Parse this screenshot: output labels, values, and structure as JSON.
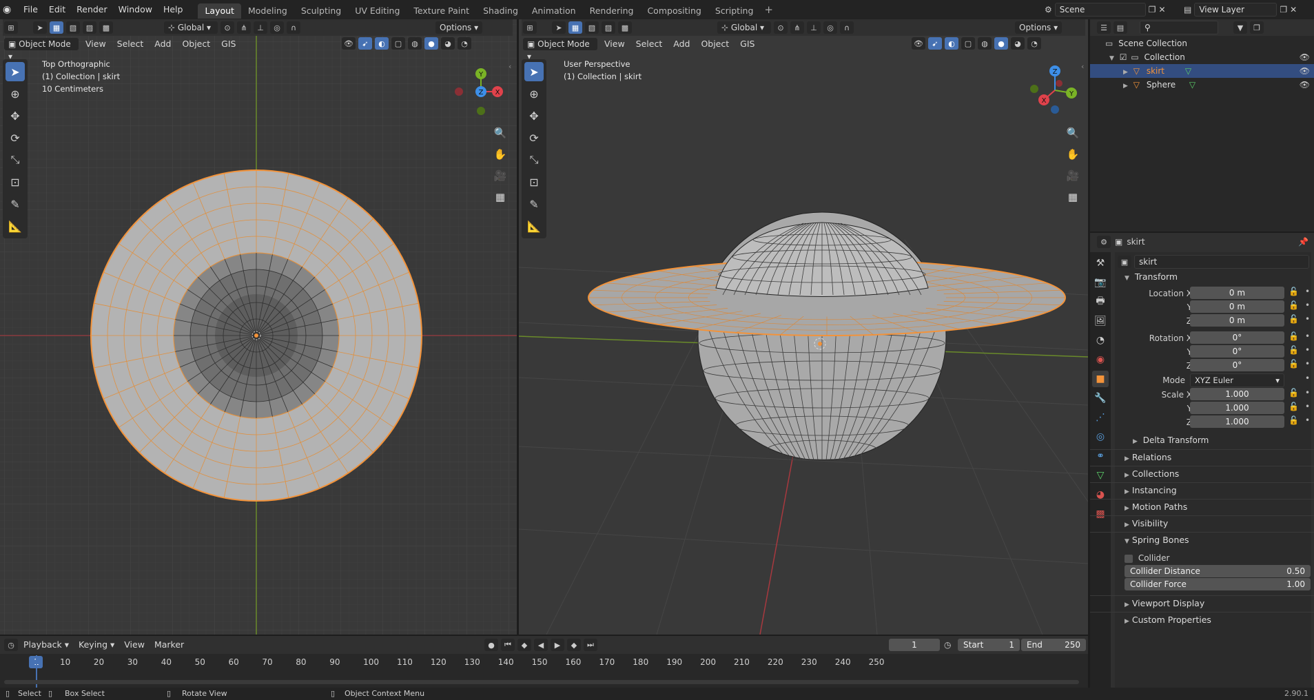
{
  "menu": [
    "File",
    "Edit",
    "Render",
    "Window",
    "Help"
  ],
  "workspaces": [
    "Layout",
    "Modeling",
    "Sculpting",
    "UV Editing",
    "Texture Paint",
    "Shading",
    "Animation",
    "Rendering",
    "Compositing",
    "Scripting"
  ],
  "active_workspace": "Layout",
  "scene_name": "Scene",
  "view_layer": "View Layer",
  "left_view": {
    "mode": "Object Mode",
    "menus": [
      "View",
      "Select",
      "Add",
      "Object",
      "GIS"
    ],
    "transform": "Global",
    "options": "Options",
    "info": [
      "Top Orthographic",
      "(1) Collection | skirt",
      "10 Centimeters"
    ],
    "gizmo": {
      "y": "Y",
      "z": "Z",
      "x": "X"
    }
  },
  "right_view": {
    "mode": "Object Mode",
    "menus": [
      "View",
      "Select",
      "Add",
      "Object",
      "GIS"
    ],
    "transform": "Global",
    "options": "Options",
    "info": [
      "User Perspective",
      "(1) Collection | skirt"
    ],
    "gizmo": {
      "y": "Y",
      "z": "Z",
      "x": "X"
    }
  },
  "outliner": {
    "root": "Scene Collection",
    "collection": "Collection",
    "items": [
      "skirt",
      "Sphere"
    ],
    "selected": "skirt"
  },
  "properties": {
    "object_name": "skirt",
    "object_field": "skirt",
    "transform_title": "Transform",
    "location": {
      "label_x": "Location X",
      "label_y": "Y",
      "label_z": "Z",
      "x": "0 m",
      "y": "0 m",
      "z": "0 m"
    },
    "rotation": {
      "label_x": "Rotation X",
      "label_y": "Y",
      "label_z": "Z",
      "x": "0°",
      "y": "0°",
      "z": "0°"
    },
    "mode_label": "Mode",
    "mode_value": "XYZ Euler",
    "scale": {
      "label_x": "Scale X",
      "label_y": "Y",
      "label_z": "Z",
      "x": "1.000",
      "y": "1.000",
      "z": "1.000"
    },
    "delta_transform": "Delta Transform",
    "panels_a": [
      "Relations",
      "Collections",
      "Instancing",
      "Motion Paths",
      "Visibility"
    ],
    "spring_bones": "Spring Bones",
    "collider": "Collider",
    "collider_distance_label": "Collider Distance",
    "collider_distance": "0.50",
    "collider_force_label": "Collider Force",
    "collider_force": "1.00",
    "panels_b": [
      "Viewport Display",
      "Custom Properties"
    ]
  },
  "timeline": {
    "menus": [
      "Playback",
      "Keying",
      "View",
      "Marker"
    ],
    "current_frame": "1",
    "start_label": "Start",
    "start": "1",
    "end_label": "End",
    "end": "250",
    "ticks": [
      "1",
      "10",
      "20",
      "30",
      "40",
      "50",
      "60",
      "70",
      "80",
      "90",
      "100",
      "110",
      "120",
      "130",
      "140",
      "150",
      "160",
      "170",
      "180",
      "190",
      "200",
      "210",
      "220",
      "230",
      "240",
      "250"
    ]
  },
  "statusbar": {
    "select": "Select",
    "box_select": "Box Select",
    "rotate_view": "Rotate View",
    "context_menu": "Object Context Menu",
    "version": "2.90.1"
  },
  "colors": {
    "accent": "#4772b3",
    "selection": "#f3933a",
    "x_axis": "#e0424b",
    "y_axis": "#7ab326",
    "z_axis": "#3d8fe8"
  }
}
